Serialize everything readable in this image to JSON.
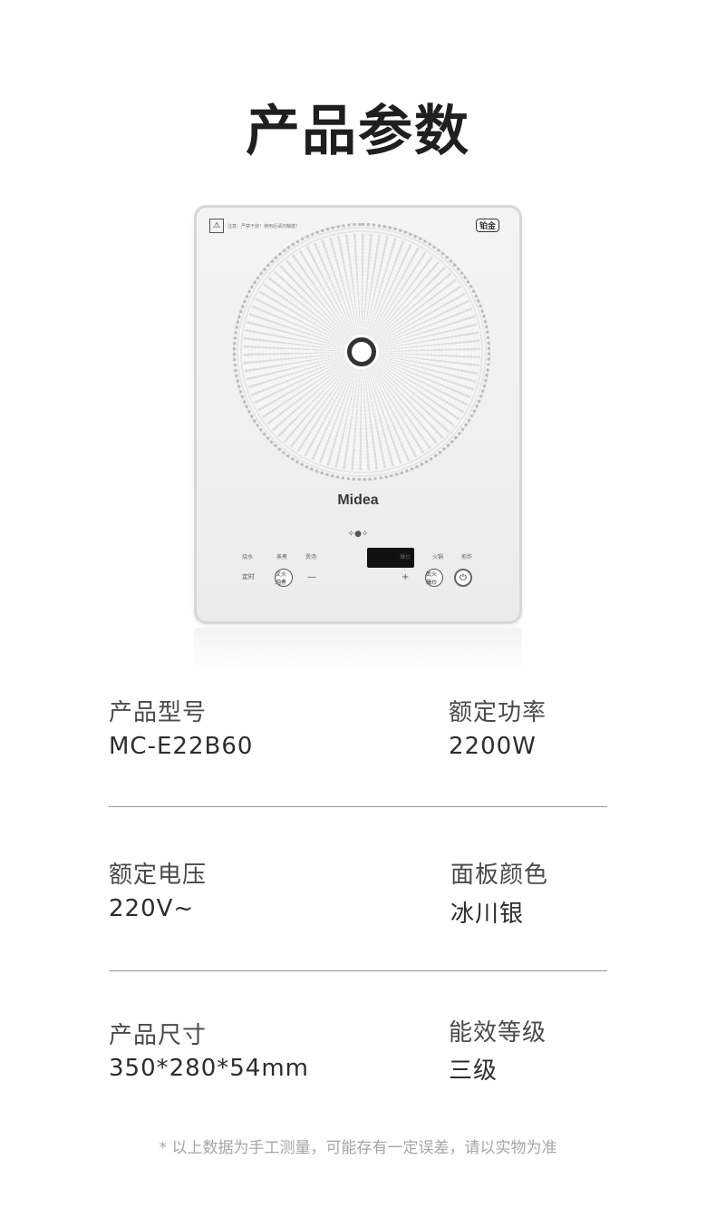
{
  "page": {
    "title": "产品参数",
    "footnote": "* 以上数据为手工测量，可能存有一定误差，请以实物为准"
  },
  "product": {
    "warning_text": "注意：严禁干烧！使用后请勿触摸！",
    "badge": "铂金",
    "brand": "Midea",
    "panel": {
      "labels_left": [
        "烧水",
        "蒸煮",
        "煲汤"
      ],
      "labels_right": [
        "爆炒",
        "火锅",
        "煎炸"
      ],
      "timer": "定时",
      "btn_wenhuo": "文火 炖煮",
      "btn_wuhuo": "武火 爆炒",
      "minus": "—",
      "plus": "+",
      "power_icon": "⏻"
    }
  },
  "specs": [
    {
      "label": "产品型号",
      "value": "MC-E22B60"
    },
    {
      "label": "额定功率",
      "value": "2200W"
    },
    {
      "label": "额定电压",
      "value": "220V~"
    },
    {
      "label": "面板颜色",
      "value": "冰川银"
    },
    {
      "label": "产品尺寸",
      "value": "350*280*54mm"
    },
    {
      "label": "能效等级",
      "value": "三级"
    }
  ]
}
